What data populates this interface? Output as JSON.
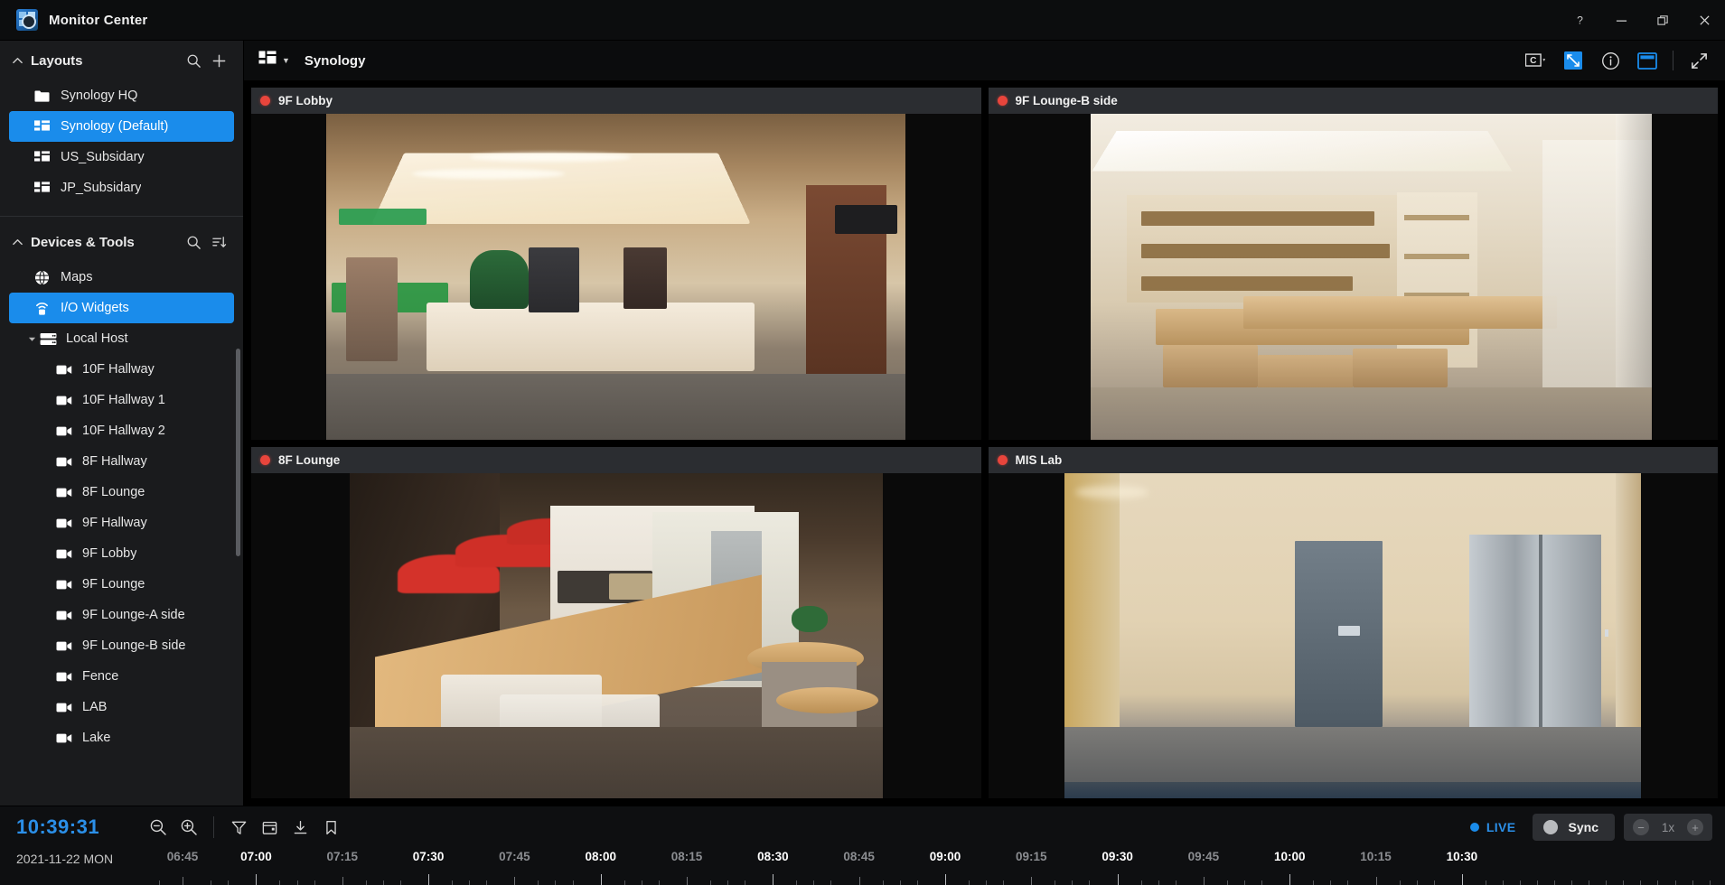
{
  "window": {
    "title": "Monitor Center",
    "app_icon": "monitor-center-logo",
    "controls": [
      {
        "name": "help",
        "glyph": "?"
      },
      {
        "name": "minimize",
        "glyph": "—"
      },
      {
        "name": "maximize",
        "glyph": "❐"
      },
      {
        "name": "close",
        "glyph": "✕"
      }
    ]
  },
  "sidebar": {
    "layouts": {
      "title": "Layouts",
      "collapse_icon": "chevron-up-icon",
      "actions": [
        {
          "name": "search-layouts",
          "icon": "search-icon"
        },
        {
          "name": "add-layout",
          "icon": "plus-icon"
        }
      ],
      "items": [
        {
          "label": "Synology HQ",
          "icon": "folder-icon",
          "selected": false
        },
        {
          "label": "Synology (Default)",
          "icon": "layout-icon",
          "selected": true
        },
        {
          "label": "US_Subsidary",
          "icon": "layout-icon",
          "selected": false
        },
        {
          "label": "JP_Subsidary",
          "icon": "layout-icon",
          "selected": false
        }
      ]
    },
    "devices": {
      "title": "Devices & Tools",
      "collapse_icon": "chevron-up-icon",
      "actions": [
        {
          "name": "search-devices",
          "icon": "search-icon"
        },
        {
          "name": "sort-devices",
          "icon": "sort-icon"
        }
      ],
      "items": [
        {
          "label": "Maps",
          "icon": "globe-icon",
          "kind": "tool",
          "selected": false
        },
        {
          "label": "I/O Widgets",
          "icon": "io-widget-icon",
          "kind": "tool",
          "selected": true
        },
        {
          "label": "Local Host",
          "icon": "server-icon",
          "kind": "host",
          "selected": false,
          "expanded": true
        },
        {
          "label": "10F Hallway",
          "icon": "camera-icon",
          "kind": "camera"
        },
        {
          "label": "10F Hallway 1",
          "icon": "camera-icon",
          "kind": "camera"
        },
        {
          "label": "10F Hallway 2",
          "icon": "camera-icon",
          "kind": "camera"
        },
        {
          "label": "8F Hallway",
          "icon": "camera-icon",
          "kind": "camera"
        },
        {
          "label": "8F Lounge",
          "icon": "camera-icon",
          "kind": "camera"
        },
        {
          "label": "9F Hallway",
          "icon": "camera-icon",
          "kind": "camera"
        },
        {
          "label": "9F Lobby",
          "icon": "camera-icon",
          "kind": "camera"
        },
        {
          "label": "9F Lounge",
          "icon": "camera-icon",
          "kind": "camera"
        },
        {
          "label": "9F Lounge-A side",
          "icon": "camera-icon",
          "kind": "camera"
        },
        {
          "label": "9F Lounge-B side",
          "icon": "camera-icon",
          "kind": "camera"
        },
        {
          "label": "Fence",
          "icon": "camera-icon",
          "kind": "camera"
        },
        {
          "label": "LAB",
          "icon": "camera-icon",
          "kind": "camera"
        },
        {
          "label": "Lake",
          "icon": "camera-icon",
          "kind": "camera"
        }
      ]
    }
  },
  "main_header": {
    "layout_icon": "layout-icon",
    "dropdown_icon": "chevron-down-icon",
    "title": "Synology",
    "right_buttons": [
      {
        "name": "channel-selector",
        "icon": "channel-icon",
        "has_caret": true,
        "active": false
      },
      {
        "name": "fit-to-window",
        "icon": "fit-screen-icon",
        "active": true
      },
      {
        "name": "info",
        "icon": "info-icon",
        "active": false
      },
      {
        "name": "panel-toggle",
        "icon": "panel-icon",
        "active": false
      },
      {
        "name": "fullscreen",
        "icon": "expand-arrows-icon",
        "active": false
      }
    ]
  },
  "tiles": [
    {
      "name": "9F Lobby",
      "recording": true,
      "status_color": "#e8453c",
      "scene": "lobby"
    },
    {
      "name": "9F Lounge-B side",
      "recording": true,
      "status_color": "#e8453c",
      "scene": "lounge-b"
    },
    {
      "name": "8F Lounge",
      "recording": true,
      "status_color": "#e8453c",
      "scene": "lounge-8f"
    },
    {
      "name": "MIS Lab",
      "recording": true,
      "status_color": "#e8453c",
      "scene": "mis-lab"
    }
  ],
  "footer": {
    "clock": "10:39:31",
    "date": "2021-11-22 MON",
    "tools": [
      {
        "name": "zoom-out",
        "icon": "zoom-out-icon"
      },
      {
        "name": "zoom-in",
        "icon": "zoom-in-icon"
      },
      {
        "name": "filter",
        "icon": "filter-icon"
      },
      {
        "name": "calendar",
        "icon": "calendar-icon"
      },
      {
        "name": "download",
        "icon": "download-icon"
      },
      {
        "name": "bookmark",
        "icon": "bookmark-icon"
      }
    ],
    "live_label": "LIVE",
    "live_color": "#2b8fe8",
    "sync_label": "Sync",
    "speed_value": "1x",
    "speed_decrease": "−",
    "speed_increase": "+",
    "timeline_ticks": [
      {
        "label": "06:45",
        "major": false,
        "pos": 1.5
      },
      {
        "label": "07:00",
        "major": true,
        "pos": 6.2
      },
      {
        "label": "07:15",
        "major": false,
        "pos": 11.7
      },
      {
        "label": "07:30",
        "major": true,
        "pos": 17.2
      },
      {
        "label": "07:45",
        "major": false,
        "pos": 22.7
      },
      {
        "label": "08:00",
        "major": true,
        "pos": 28.2
      },
      {
        "label": "08:15",
        "major": false,
        "pos": 33.7
      },
      {
        "label": "08:30",
        "major": true,
        "pos": 39.2
      },
      {
        "label": "08:45",
        "major": false,
        "pos": 44.7
      },
      {
        "label": "09:00",
        "major": true,
        "pos": 50.2
      },
      {
        "label": "09:15",
        "major": false,
        "pos": 55.7
      },
      {
        "label": "09:30",
        "major": true,
        "pos": 61.2
      },
      {
        "label": "09:45",
        "major": false,
        "pos": 66.7
      },
      {
        "label": "10:00",
        "major": true,
        "pos": 72.2
      },
      {
        "label": "10:15",
        "major": false,
        "pos": 77.7
      },
      {
        "label": "10:30",
        "major": true,
        "pos": 83.2
      }
    ]
  }
}
